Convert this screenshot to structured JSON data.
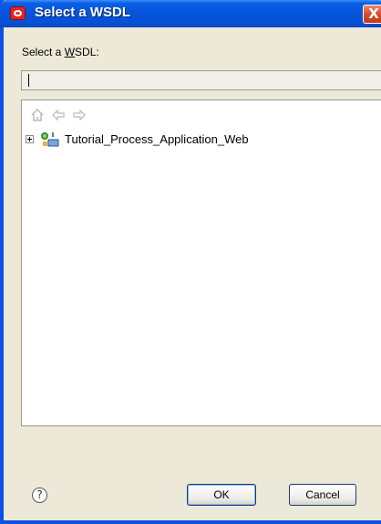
{
  "window": {
    "title": "Select a WSDL",
    "close_glyph": "X"
  },
  "field": {
    "label_prefix": "Select a ",
    "label_mnemonic": "W",
    "label_suffix": "SDL:",
    "value": ""
  },
  "toolbar": {
    "home_icon": "home-icon",
    "back_icon": "back-arrow-icon",
    "forward_icon": "forward-arrow-icon"
  },
  "tree": {
    "items": [
      {
        "label": "Tutorial_Process_Application_Web",
        "expanded": false,
        "icon": "application-server-icon"
      }
    ]
  },
  "buttons": {
    "help_glyph": "?",
    "ok": "OK",
    "cancel": "Cancel"
  },
  "colors": {
    "title_bar": "#0554d9",
    "dialog_bg": "#ece9d8",
    "close_red": "#d64b2a"
  }
}
